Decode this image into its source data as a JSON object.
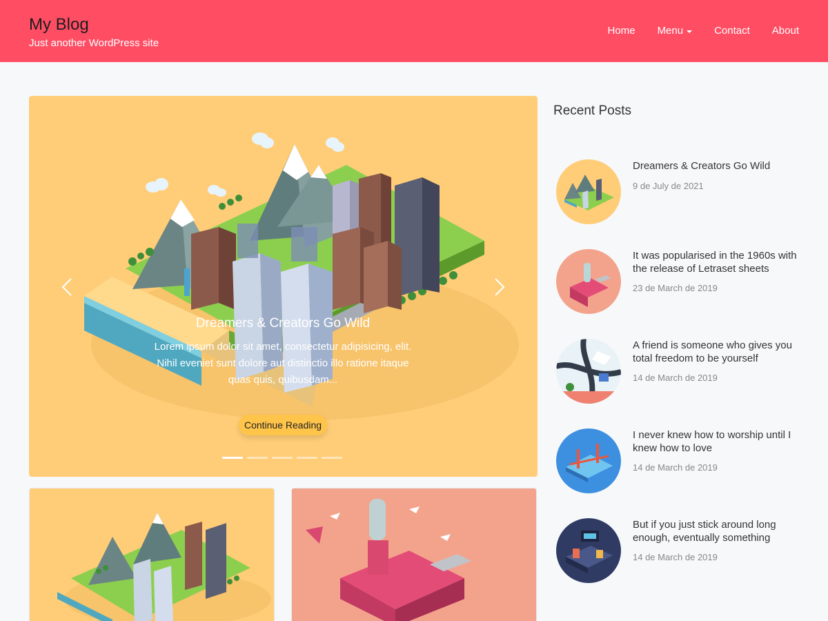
{
  "header": {
    "site_title": "My Blog",
    "tagline": "Just another WordPress site",
    "nav": [
      {
        "label": "Home"
      },
      {
        "label": "Menu"
      },
      {
        "label": "Contact"
      },
      {
        "label": "About"
      }
    ]
  },
  "hero": {
    "slide_title": "Dreamers & Creators Go Wild",
    "slide_text": "Lorem ipsum dolor sit amet, consectetur adipisicing, elit. Nihil eveniet sunt dolore aut distinctio illo ratione itaque quas quis, quibusdam...",
    "button_label": "Continue Reading",
    "slide_count": 5,
    "active_slide": 1
  },
  "sidebar": {
    "title": "Recent Posts",
    "posts": [
      {
        "title": "Dreamers & Creators Go Wild",
        "date": "9 de July de 2021"
      },
      {
        "title": "It was popularised in the 1960s with the release of Letraset sheets",
        "date": "23 de March de 2019"
      },
      {
        "title": "A friend is someone who gives you total freedom to be yourself",
        "date": "14 de March de 2019"
      },
      {
        "title": "I never knew how to worship until I knew how to love",
        "date": "14 de March de 2019"
      },
      {
        "title": "But if you just stick around long enough, eventually something",
        "date": "14 de March de 2019"
      }
    ]
  },
  "colors": {
    "header": "#ff4d64",
    "hero_bg": "#ffcd78",
    "button": "#ffc44a",
    "card_pink": "#f3a38c"
  }
}
